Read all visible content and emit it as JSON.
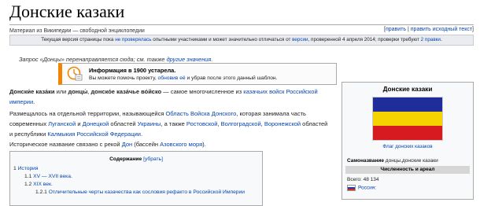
{
  "page": {
    "title": "Донские казаки",
    "subtitle": "Материал из Википедии — свободной энциклопедии",
    "edit_links": {
      "open": "[",
      "edit": "править",
      "sep": " | ",
      "edit_source": "править исходный текст",
      "close": "]"
    }
  },
  "review_bar": {
    "t1": "Текущая версия страницы пока ",
    "l1": "не проверялась",
    "t2": " опытными участниками и может значительно отличаться от ",
    "l2": "версии",
    "t3": ", проверенной 4 апреля 2014; проверки требуют ",
    "l3": "2 правки",
    "t4": "."
  },
  "hatnote": {
    "t1": "Запрос «Донцы» перенаправляется сюда; см. также ",
    "l1": "другие значения",
    "t2": "."
  },
  "ambox": {
    "icon": "outdated-clock-icon",
    "title": "Информация в 1900 устарела.",
    "t1": "Вы можете помочь проекту, ",
    "l1": "обновив её",
    "t2": " и убрав после этого данный шаблон."
  },
  "intro": {
    "b1": "Донски́е каза́ки",
    "t1": " или ",
    "b2": "донцы́",
    "t2": ", ",
    "b3": "донско́е каза́чье во́йско",
    "t3": " — самое многочисленное из ",
    "l1": "казачьих войск Российской империи",
    "t4": "."
  },
  "para2": {
    "t1": "Размещалось на отдельной территории, называющейся ",
    "l1": "Область Войска Донского",
    "t2": ", которая занимала часть современных ",
    "l2": "Луганской",
    "t3": " и ",
    "l3": "Донецкой",
    "t4": " областей ",
    "l4": "Украины",
    "t5": ", а также ",
    "l5": "Ростовской",
    "t6": ", ",
    "l6": "Волгоградской",
    "t7": ", ",
    "l7": "Воронежской",
    "t8": " областей и республики ",
    "l8": "Калмыкия",
    "t9": " ",
    "l9": "Российской Федерации",
    "t10": "."
  },
  "para3": {
    "t1": "Историческое название связано с рекой ",
    "l1": "Дон",
    "t2": " (бассейн ",
    "l2": "Азовского моря",
    "t3": ")."
  },
  "toc": {
    "title": "Содержание",
    "toggle": "[убрать]",
    "items": [
      {
        "num": "1",
        "label": "История"
      },
      {
        "num": "1.1",
        "label": "XV — XVII века."
      },
      {
        "num": "1.2",
        "label": "XIX век."
      },
      {
        "num": "1.2.1",
        "label": "Отличительные черты казачества как сословия рефакто в Российской Империи"
      }
    ]
  },
  "infobox": {
    "title": "Донские казаки",
    "flag_caption": "Флаг донских казаков",
    "self_name_label": "Самоназвание",
    "self_name_value": " донцы,донские казаки",
    "section": "Численность и ареал",
    "total_label": "Всего: 48 134",
    "country_link": "Россия",
    "country_suffix": ":",
    "flag_colors": [
      "#1f2d9a",
      "#f5d300",
      "#d71920"
    ],
    "russia_flag_colors": [
      "#ffffff",
      "#1c3bb3",
      "#d52b1e"
    ]
  }
}
